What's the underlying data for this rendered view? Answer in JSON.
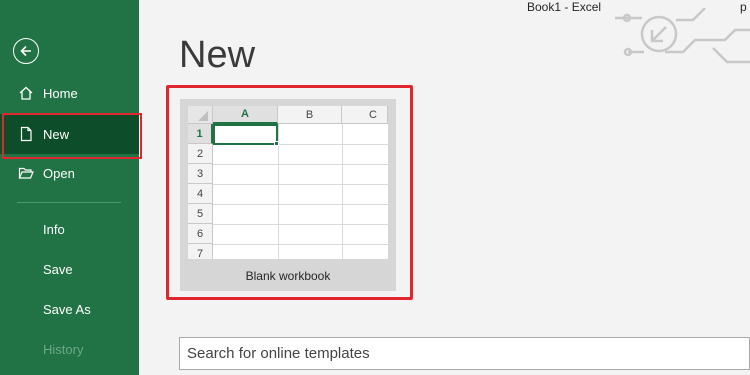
{
  "app": {
    "window_title": "Book1  -  Excel",
    "user_initials": "p"
  },
  "sidebar": {
    "items": [
      {
        "label": "Home",
        "icon": "home-icon"
      },
      {
        "label": "New",
        "icon": "new-file-icon",
        "selected": true
      },
      {
        "label": "Open",
        "icon": "open-folder-icon"
      },
      {
        "label": "Info"
      },
      {
        "label": "Save"
      },
      {
        "label": "Save As"
      },
      {
        "label": "History",
        "disabled": true
      }
    ],
    "back_icon": "back-arrow-icon"
  },
  "main": {
    "title": "New",
    "templates": [
      {
        "label": "Blank workbook",
        "columns": [
          "A",
          "B",
          "C"
        ],
        "rows": [
          "1",
          "2",
          "3",
          "4",
          "5",
          "6",
          "7"
        ],
        "active_column": "A",
        "active_row": "1"
      }
    ],
    "search": {
      "placeholder": "Search for online templates"
    }
  },
  "colors": {
    "sidebar_green": "#217346",
    "selected_green": "#0e4d2a",
    "highlight_red": "#e0262e"
  }
}
